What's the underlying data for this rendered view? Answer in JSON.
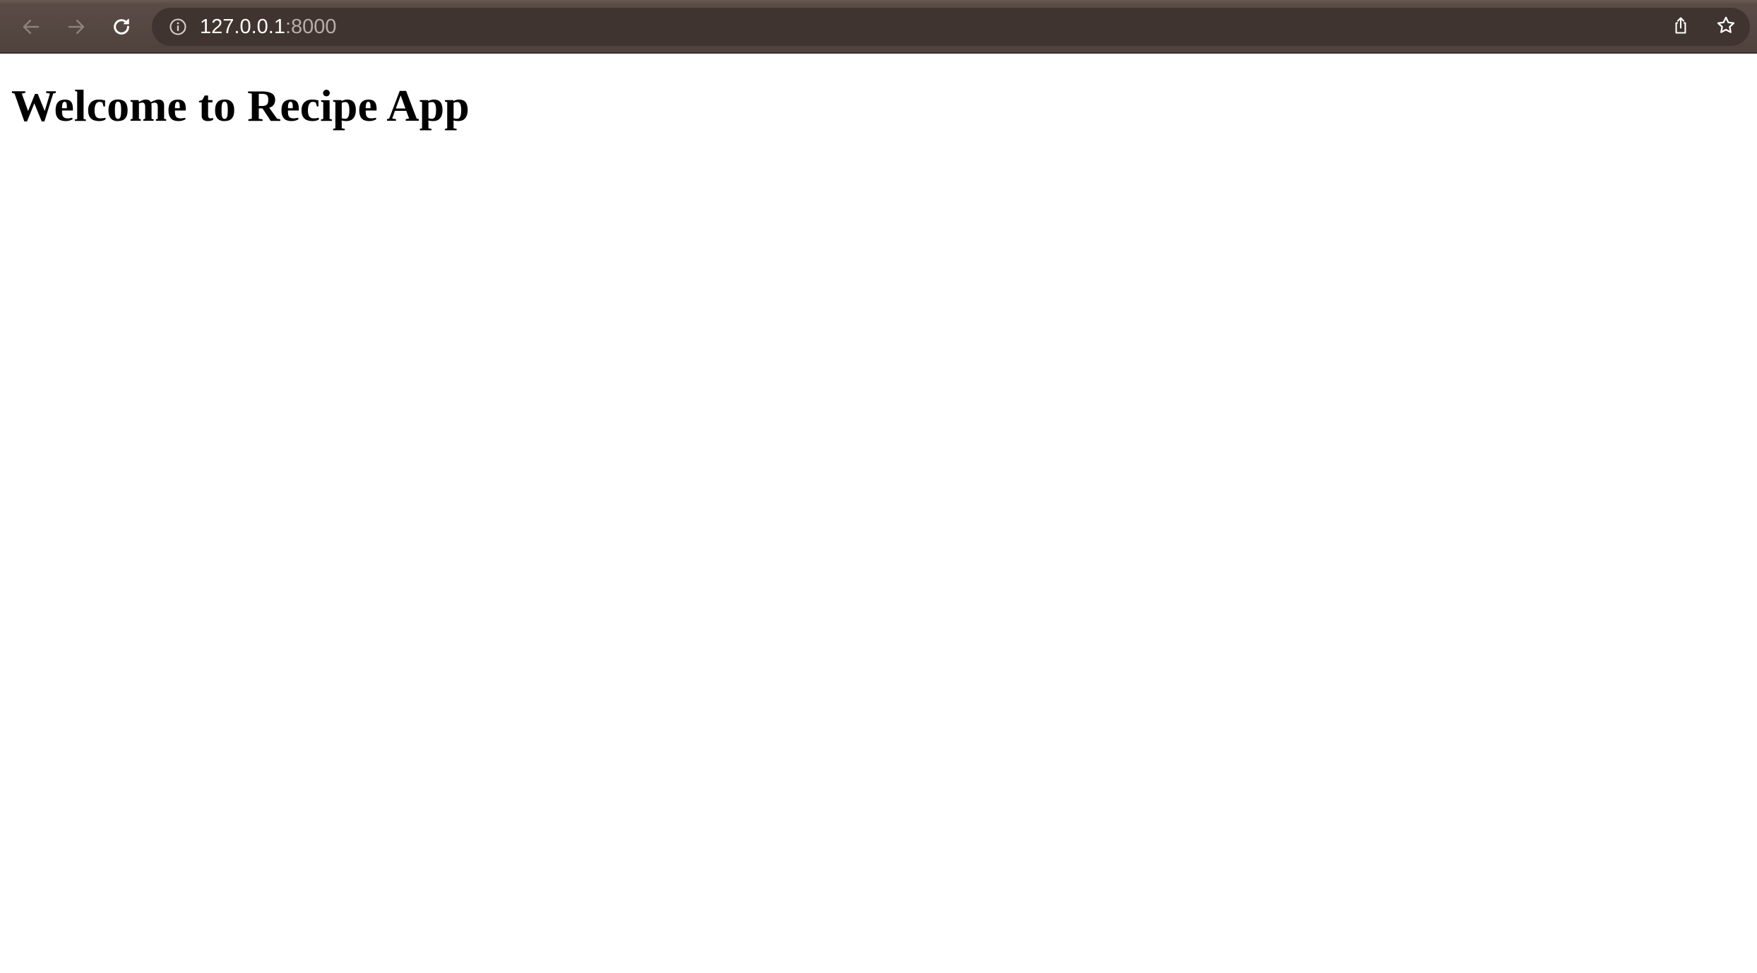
{
  "browser": {
    "url_host": "127.0.0.1",
    "url_port": ":8000",
    "icons": {
      "back": "arrow-left-icon",
      "forward": "arrow-right-icon",
      "reload": "reload-icon",
      "site_info": "info-icon",
      "share": "share-icon",
      "bookmark": "star-icon"
    },
    "colors": {
      "toolbar": "#4f423d",
      "omnibox": "#3f3430",
      "url_text": "#ffffff",
      "url_port_text": "#b8aea9"
    }
  },
  "page": {
    "heading": "Welcome to Recipe App",
    "background": "#ffffff"
  }
}
